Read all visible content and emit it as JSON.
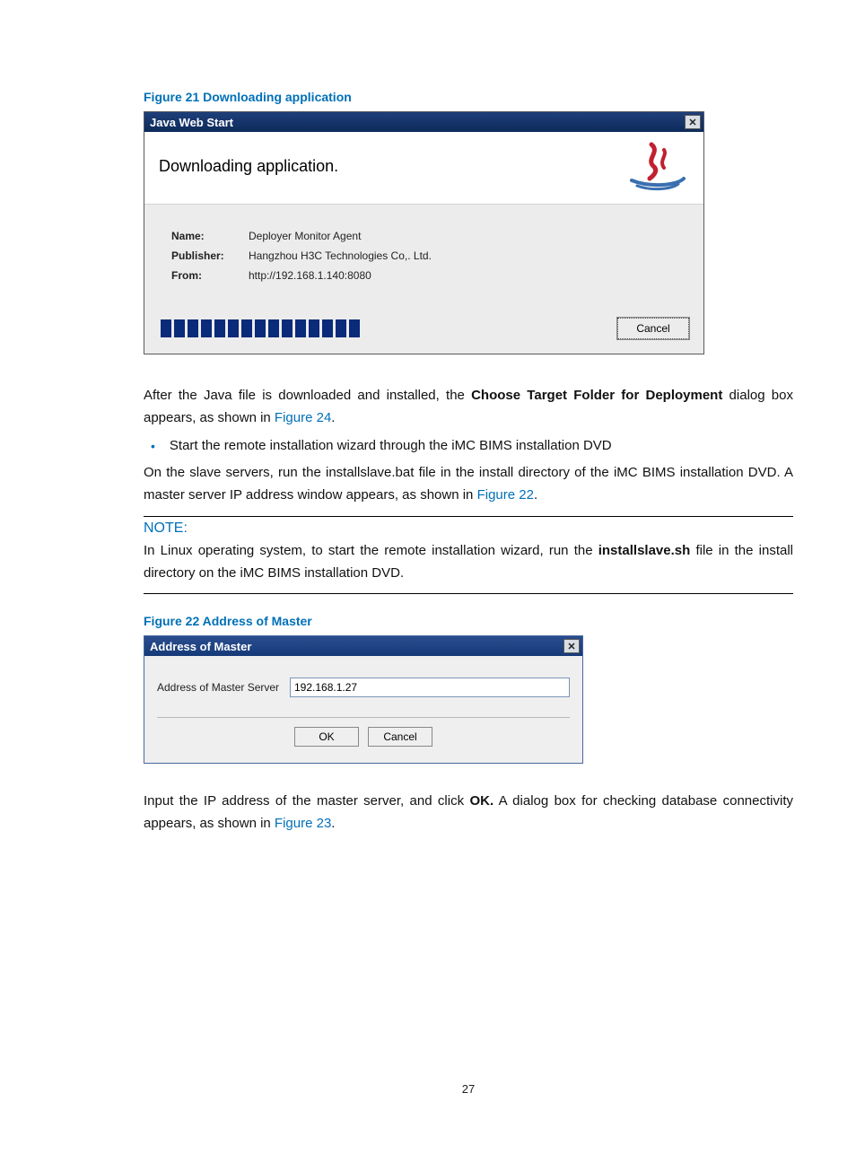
{
  "figure21_caption": "Figure 21 Downloading application",
  "jws": {
    "title": "Java Web Start",
    "heading": "Downloading application.",
    "name_label": "Name:",
    "name_value": "Deployer Monitor Agent",
    "publisher_label": "Publisher:",
    "publisher_value": "Hangzhou H3C Technologies Co,. Ltd.",
    "from_label": "From:",
    "from_value": "http://192.168.1.140:8080",
    "cancel": "Cancel"
  },
  "para1_a": "After the Java file is downloaded and installed, the ",
  "para1_bold": "Choose Target Folder for Deployment",
  "para1_b": " dialog box appears, as shown in ",
  "para1_link": "Figure 24",
  "para1_c": ".",
  "bullet1": "Start the remote installation wizard through the iMC BIMS installation DVD",
  "para2_a": "On the slave servers, run the installslave.bat file in the install directory of the iMC BIMS installation DVD. A master server IP address window appears, as shown in ",
  "para2_link": "Figure 22",
  "para2_b": ".",
  "note_heading": "NOTE:",
  "note_a": "In Linux operating system, to start the remote installation wizard, run the ",
  "note_bold": "installslave.sh",
  "note_b": " file in the install directory on the iMC BIMS installation DVD.",
  "figure22_caption": "Figure 22 Address of Master",
  "aom": {
    "title": "Address of Master",
    "label": "Address of Master Server",
    "value": "192.168.1.27",
    "ok": "OK",
    "cancel": "Cancel"
  },
  "para3_a": "Input the IP address of the master server, and click ",
  "para3_bold": "OK.",
  "para3_b": " A dialog box for checking database connectivity appears, as shown in ",
  "para3_link": "Figure 23",
  "para3_c": ".",
  "page_number": "27"
}
